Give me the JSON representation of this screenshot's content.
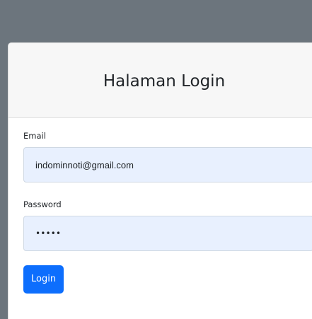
{
  "colors": {
    "topbar": "#6c757d",
    "card_header_bg": "#f7f7f7",
    "input_bg": "#e8f0fe",
    "primary": "#0d6efd"
  },
  "login": {
    "title": "Halaman Login",
    "email_label": "Email",
    "email_value": "indominnoti@gmail.com",
    "password_label": "Password",
    "password_value": "•••••",
    "login_button": "Login"
  }
}
